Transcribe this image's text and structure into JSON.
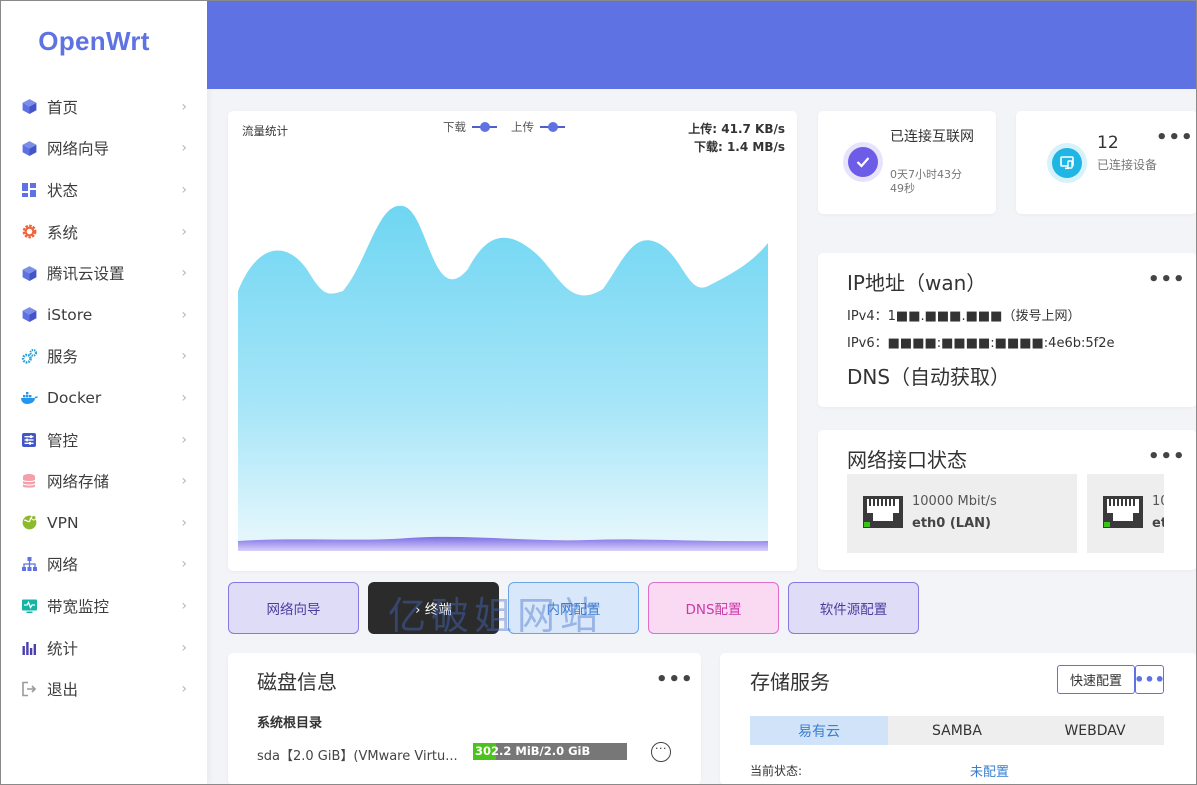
{
  "brand": "OpenWrt",
  "sidebar": {
    "items": [
      {
        "label": "首页",
        "icon": "cube-icon"
      },
      {
        "label": "网络向导",
        "icon": "cube-icon"
      },
      {
        "label": "状态",
        "icon": "grid-icon"
      },
      {
        "label": "系统",
        "icon": "gear-icon"
      },
      {
        "label": "腾讯云设置",
        "icon": "cube-icon"
      },
      {
        "label": "iStore",
        "icon": "cube-icon"
      },
      {
        "label": "服务",
        "icon": "gears-icon"
      },
      {
        "label": "Docker",
        "icon": "docker-icon"
      },
      {
        "label": "管控",
        "icon": "sliders-icon"
      },
      {
        "label": "网络存储",
        "icon": "database-icon"
      },
      {
        "label": "VPN",
        "icon": "globe-icon"
      },
      {
        "label": "网络",
        "icon": "network-icon"
      },
      {
        "label": "带宽监控",
        "icon": "monitor-icon"
      },
      {
        "label": "统计",
        "icon": "bar-chart-icon"
      },
      {
        "label": "退出",
        "icon": "logout-icon"
      }
    ],
    "chevron": "›"
  },
  "traffic": {
    "title": "流量统计",
    "legend_download": "下载",
    "legend_upload": "上传",
    "upload_rate": "上传: 41.7 KB/s",
    "download_rate": "下载: 1.4 MB/s"
  },
  "quick_actions": [
    "网络向导",
    "› 终端",
    "内网配置",
    "DNS配置",
    "软件源配置"
  ],
  "watermark": "亿破姐网站",
  "connection": {
    "title": "已连接互联网",
    "uptime": "0天7小时43分49秒"
  },
  "devices": {
    "count": "12",
    "label": "已连接设备"
  },
  "more": "•••",
  "ip": {
    "title": "IP地址（wan）",
    "ipv4_label": "IPv4：",
    "ipv4_value": "1■■.■■■.■■■（拨号上网）",
    "ipv6_label": "IPv6：",
    "ipv6_value": "■■■■:■■■■:■■■■:4e6b:5f2e",
    "dns": "DNS（自动获取）"
  },
  "interfaces": {
    "title": "网络接口状态",
    "ports": [
      {
        "speed": "10000 Mbit/s",
        "name": "eth0 (LAN)"
      },
      {
        "speed": "10",
        "name": "et"
      }
    ]
  },
  "disk": {
    "title": "磁盘信息",
    "section": "系统根目录",
    "device": "sda【2.0 GiB】(VMware Virtu...",
    "usage_text": "302.2 MiB/2.0 GiB",
    "usage_fraction": 0.148,
    "action": "···"
  },
  "storage": {
    "title": "存储服务",
    "quick_config": "快速配置",
    "tabs": [
      "易有云",
      "SAMBA",
      "WEBDAV"
    ],
    "active_tab": 0,
    "status_label": "当前状态:",
    "status_value": "未配置"
  },
  "colors": {
    "accent": "#5e72e4",
    "download_fill": "#6fd6f2",
    "upload_fill": "#8e7ee8"
  }
}
